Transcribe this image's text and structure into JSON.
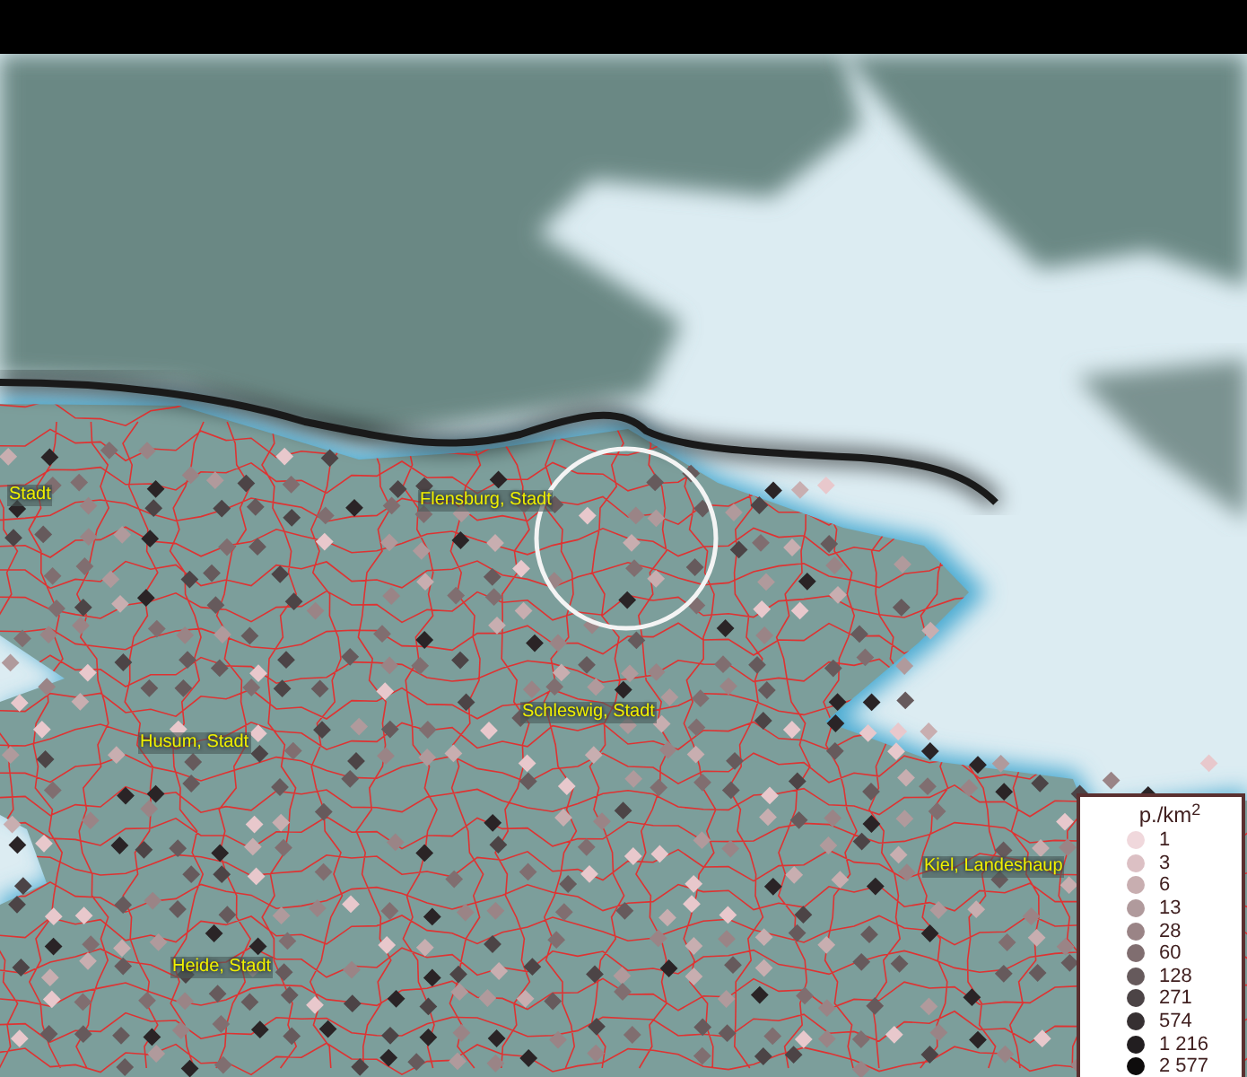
{
  "map_labels": [
    {
      "text": "Stadt"
    },
    {
      "text": "Flensburg, Stadt"
    },
    {
      "text": "Schleswig, Stadt"
    },
    {
      "text": "Husum, Stadt"
    },
    {
      "text": "Kiel, Landeshaup"
    },
    {
      "text": "Heide, Stadt"
    }
  ],
  "legend": {
    "title": "p./km$^{2}$",
    "items": [
      {
        "label": "1",
        "color": "#f0d8dc"
      },
      {
        "label": "3",
        "color": "#dcc0c4"
      },
      {
        "label": "6",
        "color": "#c8aeb0"
      },
      {
        "label": "13",
        "color": "#b09a9c"
      },
      {
        "label": "28",
        "color": "#9a8486"
      },
      {
        "label": "60",
        "color": "#806e70"
      },
      {
        "label": "128",
        "color": "#665a5c"
      },
      {
        "label": "271",
        "color": "#4c4446"
      },
      {
        "label": "574",
        "color": "#363032"
      },
      {
        "label": "1 216",
        "color": "#221e20"
      },
      {
        "label": "2 577",
        "color": "#0e0c0c"
      }
    ]
  }
}
